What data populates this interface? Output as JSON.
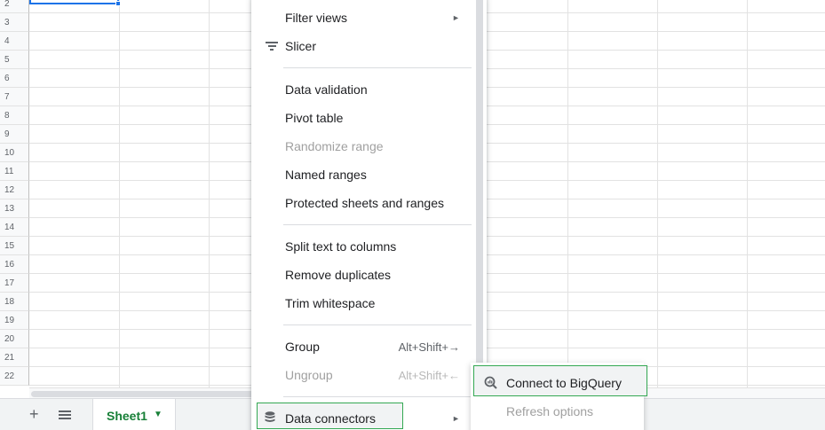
{
  "grid": {
    "rows": [
      "2",
      "3",
      "4",
      "5",
      "6",
      "7",
      "8",
      "9",
      "10",
      "11",
      "12",
      "13",
      "14",
      "15",
      "16",
      "17",
      "18",
      "19",
      "20",
      "21",
      "22"
    ]
  },
  "menu": {
    "filter_views": "Filter views",
    "slicer": "Slicer",
    "data_validation": "Data validation",
    "pivot_table": "Pivot table",
    "randomize_range": "Randomize range",
    "named_ranges": "Named ranges",
    "protected_sheets": "Protected sheets and ranges",
    "split_text": "Split text to columns",
    "remove_duplicates": "Remove duplicates",
    "trim_whitespace": "Trim whitespace",
    "group": "Group",
    "group_shortcut": "Alt+Shift+→",
    "ungroup": "Ungroup",
    "ungroup_shortcut": "Alt+Shift+←",
    "data_connectors": "Data connectors",
    "submenu_arrow": "►"
  },
  "submenu": {
    "connect_bigquery": "Connect to BigQuery",
    "refresh_options": "Refresh options"
  },
  "sheet_bar": {
    "add": "+",
    "tab_label": "Sheet1",
    "tab_caret": "▼"
  },
  "colors": {
    "selection": "#1a73e8",
    "highlight_border": "#34a853",
    "sheet_tab_text": "#188038"
  },
  "icons": {
    "slicer": "filter-lines-icon",
    "data_connectors": "database-icon",
    "bigquery": "bigquery-magnifier-icon",
    "all_sheets": "hamburger-icon"
  }
}
